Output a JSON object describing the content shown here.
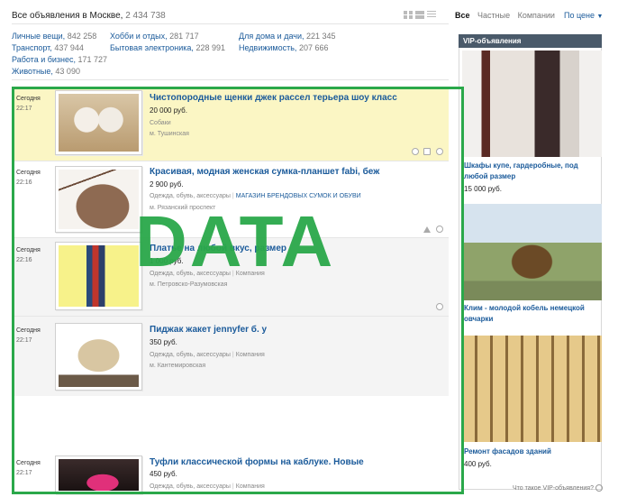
{
  "header": {
    "title": "Все объявления в Москве,",
    "count": "2 434 738"
  },
  "filters": {
    "all": "Все",
    "private": "Частные",
    "companies": "Компании"
  },
  "sort": {
    "label": "По цене"
  },
  "categories": [
    {
      "label": "Личные вещи,",
      "count": "842 258"
    },
    {
      "label": "Хобби и отдых,",
      "count": "281 717"
    },
    {
      "label": "Для дома и дачи,",
      "count": "221 345"
    },
    {
      "label": "Транспорт,",
      "count": "437 944"
    },
    {
      "label": "Бытовая электроника,",
      "count": "228 991"
    },
    {
      "label": "Недвижимость,",
      "count": "207 666"
    },
    {
      "label": "Работа и бизнес,",
      "count": "171 727"
    },
    {
      "label": "Животные,",
      "count": "43 090"
    }
  ],
  "listings": [
    {
      "date": "Сегодня",
      "time": "22:17",
      "title": "Чистопородные щенки джек рассел терьера шоу класс",
      "price": "20 000 руб.",
      "category": "Собаки",
      "seller": "",
      "metro": "м. Тушинская"
    },
    {
      "date": "Сегодня",
      "time": "22:16",
      "title": "Красивая, модная женская сумка-планшет fabi, беж",
      "price": "2 900 руб.",
      "category": "Одежда, обувь, аксессуары",
      "seller": "МАГАЗИН БРЕНДОВЫХ СУМОК И ОБУВИ",
      "metro": "м. Рязанский проспект"
    },
    {
      "date": "Сегодня",
      "time": "22:16",
      "title": "Платье на любой вкус, размер",
      "price": "1 000 руб.",
      "category": "Одежда, обувь, аксессуары",
      "seller": "Компания",
      "metro": "м. Петровско-Разумовская"
    },
    {
      "date": "Сегодня",
      "time": "22:17",
      "title": "Пиджак жакет jennyfer б. у",
      "price": "350 руб.",
      "category": "Одежда, обувь, аксессуары",
      "seller": "Компания",
      "metro": "м. Кантемировская"
    },
    {
      "date": "Сегодня",
      "time": "22:17",
      "title": "Туфли классической формы на каблуке. Новые",
      "price": "450 руб.",
      "category": "Одежда, обувь, аксессуары",
      "seller": "Компания",
      "metro": ""
    }
  ],
  "vip": {
    "heading": "VIP-объявления",
    "items": [
      {
        "title": "Шкафы купе, гардеробные, под любой размер",
        "price": "15 000 руб."
      },
      {
        "title": "Клим - молодой кобель немецкой овчарки",
        "price": ""
      },
      {
        "title": "Ремонт фасадов зданий",
        "price": "400 руб."
      }
    ],
    "what_is": "Что такое VIP-объявления?"
  },
  "overlay": {
    "word": "DATA"
  },
  "colors": {
    "link": "#1a5a9a",
    "highlight_row": "#fbf6c4",
    "vip_header": "#4a5a6a",
    "overlay_green": "#2aa84a"
  }
}
